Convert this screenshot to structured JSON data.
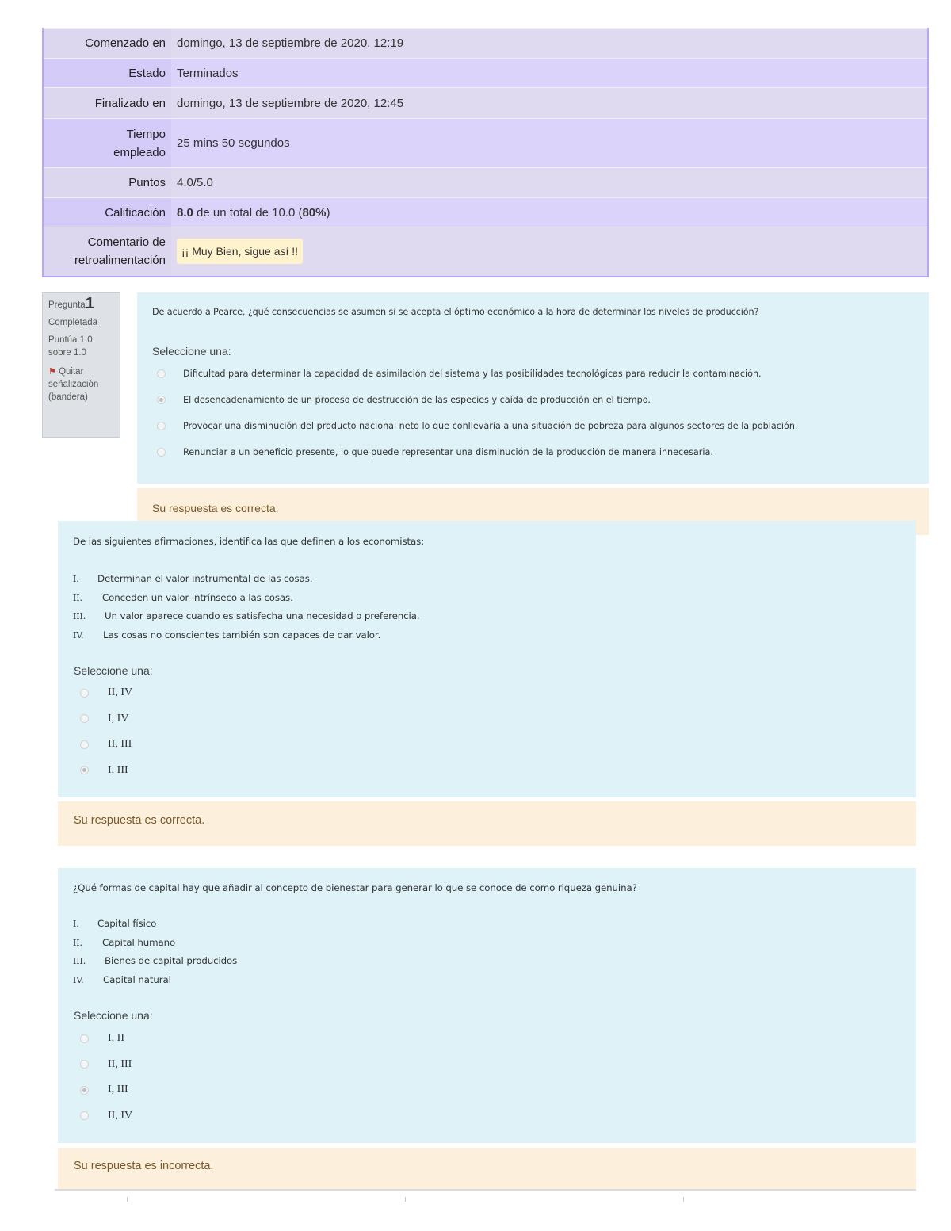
{
  "summary": {
    "rows": [
      {
        "label": "Comenzado en",
        "value": "domingo, 13 de septiembre de 2020, 12:19"
      },
      {
        "label": "Estado",
        "value": "Terminados"
      },
      {
        "label": "Finalizado en",
        "value": "domingo, 13 de septiembre de 2020, 12:45"
      },
      {
        "label": "Tiempo empleado",
        "value": "25 mins 50 segundos"
      },
      {
        "label": "Puntos",
        "value": "4.0/5.0"
      },
      {
        "label": "Calificación",
        "grade_value": "8.0",
        "grade_mid": " de un total de 10.0 (",
        "grade_percent": "80%",
        "grade_end": ")"
      },
      {
        "label": "Comentario de retroalimentación",
        "value": "¡¡ Muy Bien, sigue así !!"
      }
    ]
  },
  "questions": [
    {
      "info": {
        "label": "Pregunta",
        "number": "1",
        "state": "Completada",
        "grade": "Puntúa 1.0 sobre 1.0",
        "flag_label": "Quitar señalización (bandera)"
      },
      "text": "De acuerdo a Pearce, ¿qué consecuencias se asumen si se acepta el óptimo económico a la hora de determinar los niveles de producción?",
      "prompt": "Seleccione una:",
      "options": [
        {
          "label": "Dificultad para determinar la capacidad de asimilación del sistema y las posibilidades tecnológicas para reducir la contaminación.",
          "checked": false
        },
        {
          "label": "El desencadenamiento de un proceso de destrucción de las especies y caída de producción en el tiempo.",
          "checked": true
        },
        {
          "label": "Provocar una disminución del producto nacional neto lo que conllevaría a una situación de pobreza para algunos sectores de la población.",
          "checked": false
        },
        {
          "label": "Renunciar a un beneficio presente, lo que puede representar una disminución de la producción de manera innecesaria.",
          "checked": false
        }
      ],
      "outcome": "Su respuesta es correcta."
    },
    {
      "text": "De las siguientes afirmaciones, identifica las que definen a los economistas:",
      "statements": [
        {
          "numeral": "I.",
          "text": "Determinan el valor instrumental de las cosas."
        },
        {
          "numeral": "II.",
          "text": "Conceden un valor intrínseco a las cosas."
        },
        {
          "numeral": "III.",
          "text": "Un valor aparece cuando es satisfecha una necesidad o preferencia."
        },
        {
          "numeral": "IV.",
          "text": "Las cosas no conscientes también son capaces de dar valor."
        }
      ],
      "prompt": "Seleccione una:",
      "options": [
        {
          "label": "II, IV",
          "checked": false
        },
        {
          "label": "I, IV",
          "checked": false
        },
        {
          "label": "II, III",
          "checked": false
        },
        {
          "label": "I, III",
          "checked": true
        }
      ],
      "outcome": "Su respuesta es correcta."
    },
    {
      "text": "¿Qué formas de capital hay que añadir al concepto de bienestar para generar lo que se conoce de como riqueza genuina?",
      "statements": [
        {
          "numeral": "I.",
          "text": "Capital físico"
        },
        {
          "numeral": "II.",
          "text": "Capital humano"
        },
        {
          "numeral": "III.",
          "text": "Bienes de capital producidos"
        },
        {
          "numeral": "IV.",
          "text": "Capital natural"
        }
      ],
      "prompt": "Seleccione una:",
      "options": [
        {
          "label": "I, II",
          "checked": false
        },
        {
          "label": "II, III",
          "checked": false
        },
        {
          "label": "I, III",
          "checked": true
        },
        {
          "label": "II, IV",
          "checked": false
        }
      ],
      "outcome": "Su respuesta es incorrecta."
    }
  ],
  "colors": {
    "summary_border": "#b9a6f0",
    "question_bg": "#def2f8",
    "outcome_bg": "#fcefdc",
    "feedback_bg": "#fff3cd",
    "flag": "#c0392b"
  }
}
